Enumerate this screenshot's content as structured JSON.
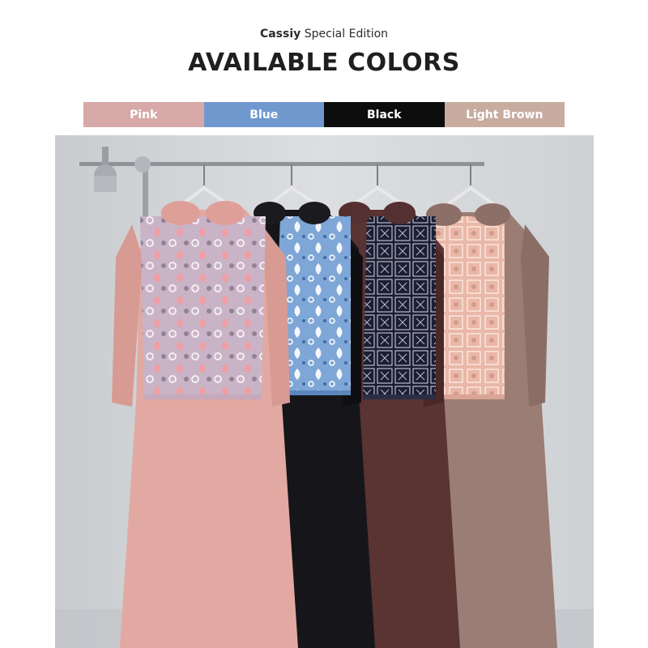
{
  "header": {
    "brand": "Cassiy",
    "edition": " Special Edition",
    "title": "AVAILABLE COLORS"
  },
  "swatches": [
    {
      "label": "Pink",
      "color": "#d7a9a8"
    },
    {
      "label": "Blue",
      "color": "#6f98cf"
    },
    {
      "label": "Black",
      "color": "#0d0d0d"
    },
    {
      "label": "Light Brown",
      "color": "#c8aca0"
    }
  ],
  "product_photo": {
    "garments": [
      {
        "color_name": "Pink",
        "body": "#e2a9a2",
        "vest": "#c9b3c6"
      },
      {
        "color_name": "Blue",
        "body": "#16161a",
        "vest": "#7ea6d6"
      },
      {
        "color_name": "Black",
        "body": "#5a3333",
        "vest": "#1c1f33"
      },
      {
        "color_name": "Light Brown",
        "body": "#9a7d74",
        "vest": "#e9b8a8"
      }
    ]
  }
}
